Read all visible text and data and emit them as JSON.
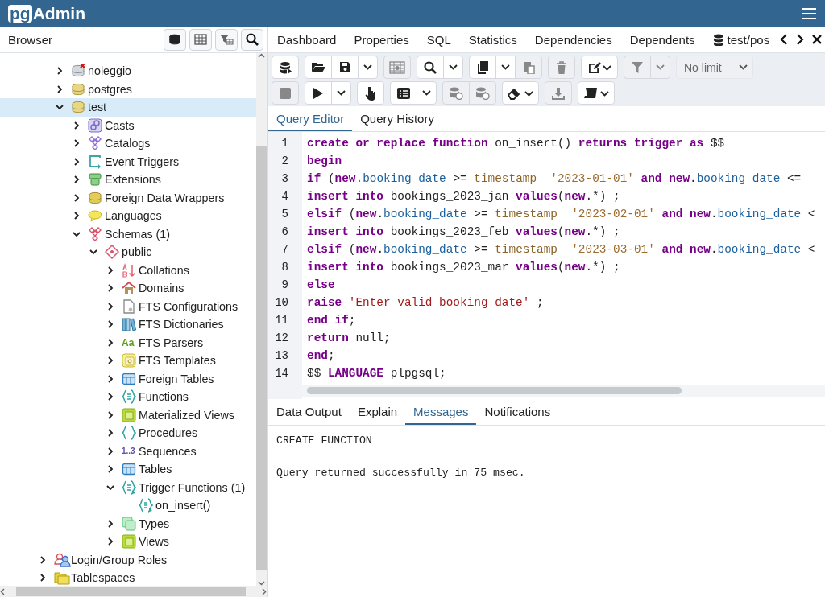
{
  "app": {
    "logo_mark": "pg",
    "logo_word": "Admin"
  },
  "browser": {
    "title": "Browser",
    "tree": [
      {
        "children": [
          {
            "label": "noleggio",
            "kind": "database",
            "connected": false,
            "expanded": false,
            "selected": false
          },
          {
            "label": "postgres",
            "kind": "database",
            "connected": true,
            "expanded": false,
            "selected": false
          },
          {
            "label": "test",
            "kind": "database",
            "connected": true,
            "expanded": true,
            "selected": true,
            "children": [
              {
                "label": "Casts",
                "kind": "casts",
                "expanded": false,
                "selected": false
              },
              {
                "label": "Catalogs",
                "kind": "catalogs",
                "expanded": false,
                "selected": false
              },
              {
                "label": "Event Triggers",
                "kind": "event_triggers",
                "expanded": false,
                "selected": false
              },
              {
                "label": "Extensions",
                "kind": "extensions",
                "expanded": false,
                "selected": false
              },
              {
                "label": "Foreign Data Wrappers",
                "kind": "fdw",
                "expanded": false,
                "selected": false
              },
              {
                "label": "Languages",
                "kind": "languages",
                "expanded": false,
                "selected": false
              },
              {
                "label": "Schemas (1)",
                "kind": "schemas",
                "expanded": true,
                "selected": false,
                "children": [
                  {
                    "label": "public",
                    "kind": "schema",
                    "expanded": true,
                    "selected": false,
                    "children": [
                      {
                        "label": "Collations",
                        "kind": "collations",
                        "expanded": false,
                        "selected": false
                      },
                      {
                        "label": "Domains",
                        "kind": "domains",
                        "expanded": false,
                        "selected": false
                      },
                      {
                        "label": "FTS Configurations",
                        "kind": "fts_config",
                        "expanded": false,
                        "selected": false
                      },
                      {
                        "label": "FTS Dictionaries",
                        "kind": "fts_dict",
                        "expanded": false,
                        "selected": false
                      },
                      {
                        "label": "FTS Parsers",
                        "kind": "fts_parser",
                        "icon_text": "Aa",
                        "expanded": false,
                        "selected": false
                      },
                      {
                        "label": "FTS Templates",
                        "kind": "fts_template",
                        "expanded": false,
                        "selected": false
                      },
                      {
                        "label": "Foreign Tables",
                        "kind": "foreign_tables",
                        "expanded": false,
                        "selected": false
                      },
                      {
                        "label": "Functions",
                        "kind": "functions",
                        "expanded": false,
                        "selected": false
                      },
                      {
                        "label": "Materialized Views",
                        "kind": "mat_views",
                        "expanded": false,
                        "selected": false
                      },
                      {
                        "label": "Procedures",
                        "kind": "procedures",
                        "expanded": false,
                        "selected": false
                      },
                      {
                        "label": "Sequences",
                        "kind": "sequences",
                        "icon_text": "1..3",
                        "expanded": false,
                        "selected": false
                      },
                      {
                        "label": "Tables",
                        "kind": "tables",
                        "expanded": false,
                        "selected": false
                      },
                      {
                        "label": "Trigger Functions (1)",
                        "kind": "trigger_functions",
                        "expanded": true,
                        "selected": false,
                        "children": [
                          {
                            "label": "on_insert()",
                            "kind": "trigger_function",
                            "selected": false
                          }
                        ]
                      },
                      {
                        "label": "Types",
                        "kind": "types",
                        "expanded": false,
                        "selected": false
                      },
                      {
                        "label": "Views",
                        "kind": "views",
                        "expanded": false,
                        "selected": false
                      }
                    ]
                  }
                ]
              }
            ]
          }
        ]
      },
      {
        "label": "Login/Group Roles",
        "kind": "roles",
        "expanded": false,
        "selected": false
      },
      {
        "label": "Tablespaces",
        "kind": "tablespaces",
        "expanded": false,
        "selected": false
      }
    ]
  },
  "object_tabs": [
    {
      "label": "Dashboard",
      "kind": "plain",
      "selected": false
    },
    {
      "label": "Properties",
      "kind": "plain",
      "selected": false
    },
    {
      "label": "SQL",
      "kind": "plain",
      "selected": false
    },
    {
      "label": "Statistics",
      "kind": "plain",
      "selected": false
    },
    {
      "label": "Dependencies",
      "kind": "plain",
      "selected": false
    },
    {
      "label": "Dependents",
      "kind": "plain",
      "selected": false
    },
    {
      "label": "test/pos",
      "kind": "query",
      "selected": false
    }
  ],
  "toolbar_rows": [
    {
      "groups": [
        [
          {
            "kind": "connection",
            "disabled": false
          }
        ],
        [
          {
            "kind": "open",
            "disabled": false
          },
          {
            "kind": "save",
            "disabled": false
          },
          {
            "kind": "caret",
            "disabled": false
          }
        ],
        [
          {
            "kind": "grid",
            "disabled": true
          }
        ],
        [
          {
            "kind": "search",
            "disabled": false
          },
          {
            "kind": "caret",
            "disabled": false
          }
        ],
        [
          {
            "kind": "copy",
            "disabled": false
          },
          {
            "kind": "caret",
            "disabled": false
          },
          {
            "kind": "paste",
            "disabled": true
          }
        ],
        [
          {
            "kind": "delete",
            "disabled": true
          }
        ],
        [
          {
            "kind": "edit",
            "disabled": false
          }
        ],
        [
          {
            "kind": "filter",
            "disabled": true
          },
          {
            "kind": "caret",
            "disabled": true
          }
        ]
      ]
    },
    {
      "groups": [
        [
          {
            "kind": "stop",
            "disabled": true
          }
        ],
        [
          {
            "kind": "play",
            "disabled": false
          },
          {
            "kind": "caret",
            "disabled": false
          }
        ],
        [
          {
            "kind": "hand",
            "disabled": false
          }
        ],
        [
          {
            "kind": "list",
            "disabled": false
          },
          {
            "kind": "caret",
            "disabled": false
          }
        ],
        [
          {
            "kind": "commit",
            "disabled": true
          },
          {
            "kind": "rollback",
            "disabled": true
          }
        ],
        [
          {
            "kind": "eraser",
            "disabled": false
          }
        ],
        [
          {
            "kind": "download",
            "disabled": true
          }
        ],
        [
          {
            "kind": "macro",
            "disabled": false
          }
        ]
      ]
    }
  ],
  "row_limit": {
    "value": "No limit",
    "disabled": true
  },
  "editor_tabs": [
    {
      "label": "Query Editor",
      "selected": true
    },
    {
      "label": "Query History",
      "selected": false
    }
  ],
  "editor": {
    "lines": [
      {
        "number": "1",
        "tokens": [
          {
            "kind": "kw",
            "text": "create or replace function"
          },
          {
            "kind": "plain",
            "text": " on_insert() "
          },
          {
            "kind": "kw",
            "text": "returns trigger as"
          },
          {
            "kind": "plain",
            "text": " $$"
          }
        ]
      },
      {
        "number": "2",
        "tokens": [
          {
            "kind": "kw",
            "text": "begin"
          }
        ]
      },
      {
        "number": "3",
        "tokens": [
          {
            "kind": "kw",
            "text": "if"
          },
          {
            "kind": "plain",
            "text": " ("
          },
          {
            "kind": "kw",
            "text": "new"
          },
          {
            "kind": "plain",
            "text": "."
          },
          {
            "kind": "prop",
            "text": "booking_date"
          },
          {
            "kind": "plain",
            "text": " >= "
          },
          {
            "kind": "type",
            "text": "timestamp"
          },
          {
            "kind": "literal",
            "text": "  '2023-01-01' "
          },
          {
            "kind": "kw",
            "text": "and new"
          },
          {
            "kind": "plain",
            "text": "."
          },
          {
            "kind": "prop",
            "text": "booking_date"
          },
          {
            "kind": "plain",
            "text": " <="
          }
        ]
      },
      {
        "number": "4",
        "tokens": [
          {
            "kind": "kw",
            "text": "insert into"
          },
          {
            "kind": "plain",
            "text": " bookings_2023_jan "
          },
          {
            "kind": "kw",
            "text": "values"
          },
          {
            "kind": "plain",
            "text": "("
          },
          {
            "kind": "kw",
            "text": "new"
          },
          {
            "kind": "plain",
            "text": ".*) ;"
          }
        ]
      },
      {
        "number": "5",
        "tokens": [
          {
            "kind": "kw",
            "text": "elsif"
          },
          {
            "kind": "plain",
            "text": " ("
          },
          {
            "kind": "kw",
            "text": "new"
          },
          {
            "kind": "plain",
            "text": "."
          },
          {
            "kind": "prop",
            "text": "booking_date"
          },
          {
            "kind": "plain",
            "text": " >= "
          },
          {
            "kind": "type",
            "text": "timestamp"
          },
          {
            "kind": "literal",
            "text": "  '2023-02-01' "
          },
          {
            "kind": "kw",
            "text": "and new"
          },
          {
            "kind": "plain",
            "text": "."
          },
          {
            "kind": "prop",
            "text": "booking_date"
          },
          {
            "kind": "plain",
            "text": " <"
          }
        ]
      },
      {
        "number": "6",
        "tokens": [
          {
            "kind": "kw",
            "text": "insert into"
          },
          {
            "kind": "plain",
            "text": " bookings_2023_feb "
          },
          {
            "kind": "kw",
            "text": "values"
          },
          {
            "kind": "plain",
            "text": "("
          },
          {
            "kind": "kw",
            "text": "new"
          },
          {
            "kind": "plain",
            "text": ".*) ;"
          }
        ]
      },
      {
        "number": "7",
        "tokens": [
          {
            "kind": "kw",
            "text": "elsif"
          },
          {
            "kind": "plain",
            "text": " ("
          },
          {
            "kind": "kw",
            "text": "new"
          },
          {
            "kind": "plain",
            "text": "."
          },
          {
            "kind": "prop",
            "text": "booking_date"
          },
          {
            "kind": "plain",
            "text": " >= "
          },
          {
            "kind": "type",
            "text": "timestamp"
          },
          {
            "kind": "literal",
            "text": "  '2023-03-01' "
          },
          {
            "kind": "kw",
            "text": "and new"
          },
          {
            "kind": "plain",
            "text": "."
          },
          {
            "kind": "prop",
            "text": "booking_date"
          },
          {
            "kind": "plain",
            "text": " <"
          }
        ]
      },
      {
        "number": "8",
        "tokens": [
          {
            "kind": "kw",
            "text": "insert into"
          },
          {
            "kind": "plain",
            "text": " bookings_2023_mar "
          },
          {
            "kind": "kw",
            "text": "values"
          },
          {
            "kind": "plain",
            "text": "("
          },
          {
            "kind": "kw",
            "text": "new"
          },
          {
            "kind": "plain",
            "text": ".*) ;"
          }
        ]
      },
      {
        "number": "9",
        "tokens": [
          {
            "kind": "kw",
            "text": "else"
          }
        ]
      },
      {
        "number": "10",
        "tokens": [
          {
            "kind": "kw",
            "text": "raise "
          },
          {
            "kind": "string",
            "text": "'Enter valid booking date'"
          },
          {
            "kind": "plain",
            "text": " ;"
          }
        ]
      },
      {
        "number": "11",
        "tokens": [
          {
            "kind": "kw",
            "text": "end if"
          },
          {
            "kind": "plain",
            "text": ";"
          }
        ]
      },
      {
        "number": "12",
        "tokens": [
          {
            "kind": "kw",
            "text": "return"
          },
          {
            "kind": "plain",
            "text": " null;"
          }
        ]
      },
      {
        "number": "13",
        "tokens": [
          {
            "kind": "kw",
            "text": "end"
          },
          {
            "kind": "plain",
            "text": ";"
          }
        ]
      },
      {
        "number": "14",
        "tokens": [
          {
            "kind": "plain",
            "text": "$$ "
          },
          {
            "kind": "kw",
            "text": "LANGUAGE"
          },
          {
            "kind": "plain",
            "text": " plpgsql;"
          }
        ]
      }
    ]
  },
  "output_tabs": [
    {
      "label": "Data Output",
      "selected": false
    },
    {
      "label": "Explain",
      "selected": false
    },
    {
      "label": "Messages",
      "selected": true
    },
    {
      "label": "Notifications",
      "selected": false
    }
  ],
  "messages": [
    "CREATE FUNCTION",
    "Query returned successfully in 75 msec."
  ]
}
